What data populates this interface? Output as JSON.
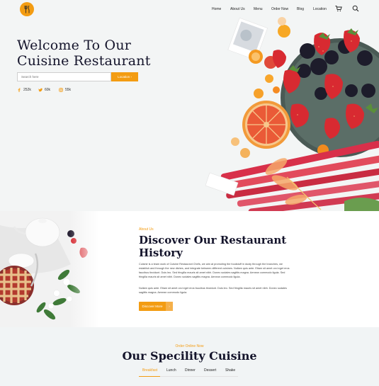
{
  "nav": {
    "items": [
      "Home",
      "About Us",
      "Menu",
      "Order Now",
      "Blog",
      "Location"
    ],
    "cart_icon": "cart-icon",
    "search_icon": "search-icon"
  },
  "brand": {
    "logo_icon": "fork-knife-icon",
    "accent": "#f39c12"
  },
  "hero": {
    "title_line1": "Welcome To Our",
    "title_line2": "Cuisine Restaurant",
    "search_placeholder": "Search here",
    "location_button": "Location",
    "location_arrow": "›",
    "social": [
      {
        "icon": "facebook-icon",
        "count": "252k"
      },
      {
        "icon": "twitter-icon",
        "count": "60k"
      },
      {
        "icon": "instagram-icon",
        "count": "55k"
      }
    ]
  },
  "about": {
    "eyebrow": "About Us",
    "title_line1": "Discover Our Restaurant",
    "title_line2": "History",
    "para1": "Cuisine is a team work of Cuisine Restaurant Chefs, we aim at promoting the foodstuff in dusty through the branches, we establish and through the new dishes, and integrate between different cuisines. Nullam quis ante. Etiam sit amet orci eget eros faucibus tincidunt. Duis leo. Sed fringilla mauris sit amet nibh. Donec sodales sagittis magna. Aenean commodo ligula. Sed fringilla mauris sit amet nibh. Donec sodales sagittis magna. Aenean commodo ligula.",
    "para2": "Nullam quis ante. Etiam sit amet orci eget eros faucibus tincidunt. Duis leo. Sed fringilla mauris sit amet nibh. Donec sodales sagittis magna. Aenean commodo ligula.",
    "button": "Discover More",
    "button_arrow": "›"
  },
  "special": {
    "eyebrow": "Order Online Now",
    "title": "Our Specility Cuisine",
    "tabs": [
      "Breakfast",
      "Lunch",
      "Dinner",
      "Dessert",
      "Shake"
    ],
    "active_tab": "Breakfast"
  }
}
